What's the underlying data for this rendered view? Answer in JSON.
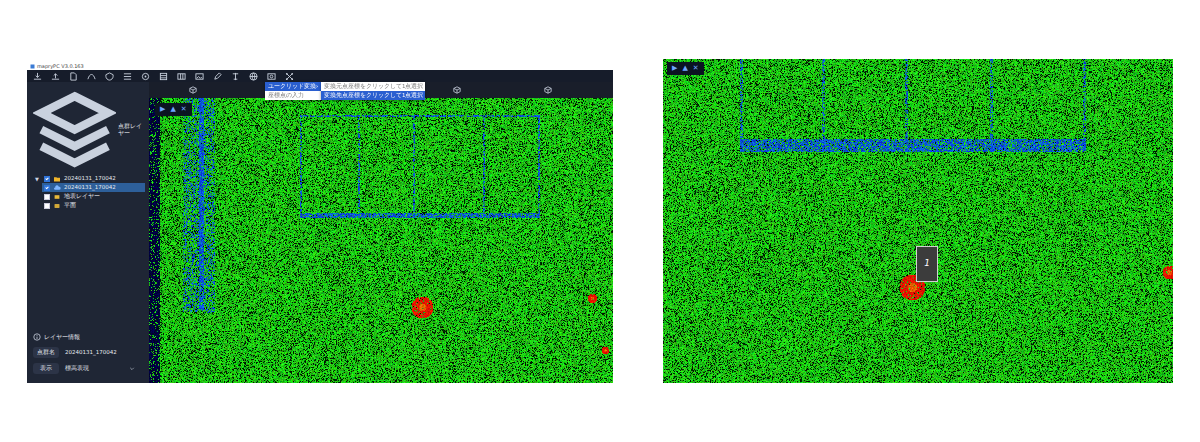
{
  "left_window": {
    "title": "mapryPC V3.0.163",
    "sidebar": {
      "header": "点群レイヤー",
      "tree": [
        {
          "label": "20240131_170042",
          "kind": "folder",
          "toggle": "▼",
          "checked": true,
          "expanded": true,
          "selected": false,
          "children": [
            {
              "label": "20240131_170042",
              "kind": "cloud",
              "checked": true,
              "selected": true
            },
            {
              "label": "地表レイヤー",
              "kind": "layer",
              "checked": false,
              "selected": false
            },
            {
              "label": "平面",
              "kind": "plane",
              "checked": false,
              "selected": false
            }
          ]
        }
      ],
      "info_header": "レイヤー情報",
      "info": [
        {
          "label": "点群名",
          "value": "20240131_170042"
        },
        {
          "label": "表示",
          "value": "標高表現"
        }
      ]
    },
    "menu": [
      {
        "label": "ユークリッド変換",
        "arrow": "›",
        "selected": true
      },
      {
        "label": "座標点の入力",
        "arrow": "",
        "selected": false
      }
    ],
    "submenu": [
      {
        "label": "変換元点座標をクリックして1点選択",
        "selected": false
      },
      {
        "label": "変換先点座標をクリックして1点選択",
        "selected": true
      }
    ],
    "viewer_controls": [
      "▶",
      "▲",
      "✕"
    ]
  },
  "right_view": {
    "viewer_controls": [
      "▶",
      "▲",
      "✕"
    ],
    "marker": {
      "label": "1"
    }
  }
}
